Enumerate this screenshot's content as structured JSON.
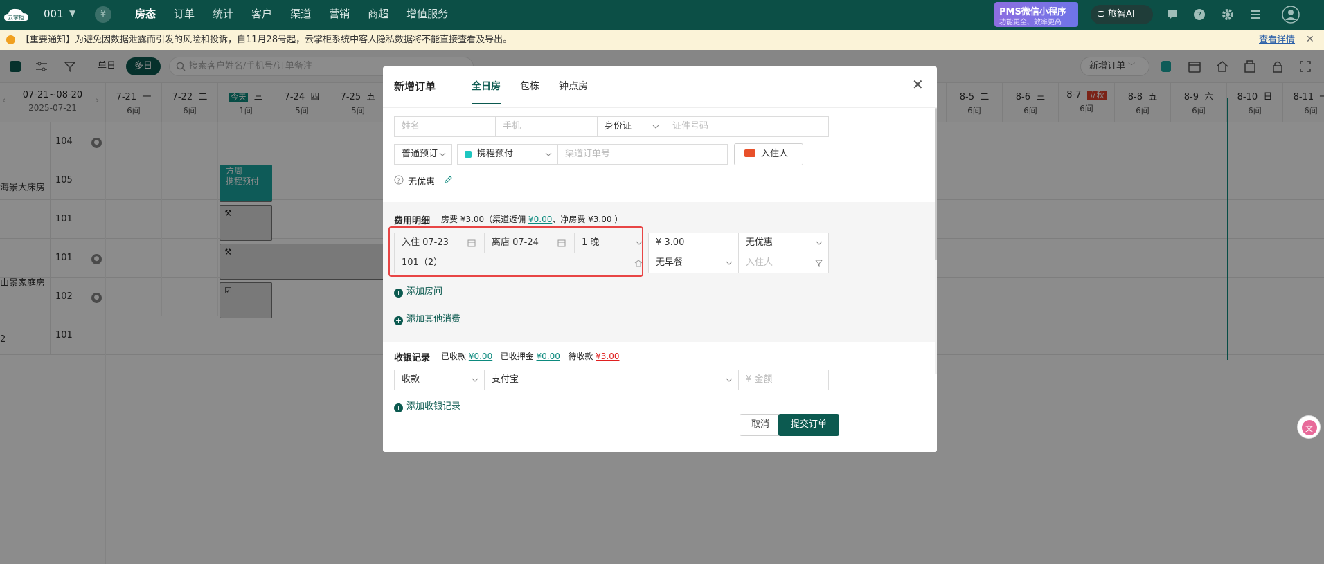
{
  "nav": {
    "logo_text": "云掌柜",
    "hotel": "001",
    "menu": [
      "房态",
      "订单",
      "统计",
      "客户",
      "渠道",
      "营销",
      "商超",
      "增值服务"
    ],
    "pms_title": "PMS微信小程序",
    "pms_sub": "功能更全、效率更高",
    "ai_label": "旅智AI",
    "yen_symbol": "¥"
  },
  "notice": {
    "message": "【重要通知】为避免因数据泄露而引发的风险和投诉，自11月28号起，云掌柜系统中客人隐私数据将不能直接查看及导出。",
    "link": "查看详情",
    "close": "✕"
  },
  "toolbar": {
    "single_day": "单日",
    "multi_day": "多日",
    "search_placeholder": "搜索客户姓名/手机号/订单备注",
    "new_order": "新增订单"
  },
  "calendar": {
    "range": "07-21~08-20",
    "range_date": "2025-07-21",
    "today_badge": "今天",
    "holiday_badge": "立秋",
    "days_left": [
      {
        "d": "7-21",
        "w": "一",
        "c": "6间"
      },
      {
        "d": "7-22",
        "w": "二",
        "c": "6间"
      },
      {
        "d": "",
        "w": "三",
        "c": "1间"
      },
      {
        "d": "7-24",
        "w": "四",
        "c": "5间"
      },
      {
        "d": "7-25",
        "w": "五",
        "c": "5间"
      }
    ],
    "days_right": [
      {
        "d": "8-5",
        "w": "二",
        "c": "6间"
      },
      {
        "d": "8-6",
        "w": "三",
        "c": "6间"
      },
      {
        "d": "8-7",
        "w": "",
        "c": "6间"
      },
      {
        "d": "8-8",
        "w": "五",
        "c": "6间"
      },
      {
        "d": "8-9",
        "w": "六",
        "c": "6间"
      },
      {
        "d": "8-10",
        "w": "日",
        "c": "6间"
      },
      {
        "d": "8-11",
        "w": "一",
        "c": "6间"
      }
    ],
    "room_types": [
      "海景大床房",
      "山景家庭房",
      "2"
    ],
    "rooms": [
      "104",
      "105",
      "101",
      "101",
      "102",
      "101"
    ],
    "booking_text": "方周\n携程预付"
  },
  "modal": {
    "title": "新增订单",
    "tabs": [
      "全日房",
      "包栋",
      "钟点房"
    ],
    "name_placeholder": "姓名",
    "phone_placeholder": "手机",
    "id_type": "身份证",
    "id_placeholder": "证件号码",
    "booking_type": "普通预订",
    "channel": "携程预付",
    "channel_order_placeholder": "渠道订单号",
    "guest_button": "入住人",
    "no_discount": "无优惠",
    "fee_title": "费用明细",
    "fee_room_prefix": "房费 ¥3.00（渠道返佣 ",
    "fee_commission": "¥0.00",
    "fee_net": "、净房费 ¥3.00 ）",
    "checkin": "入住 07-23",
    "checkout": "离店 07-24",
    "nights": "1 晚",
    "price": "¥ 3.00",
    "discount_select": "无优惠",
    "room_select": "101（2）",
    "breakfast": "无早餐",
    "guest_placeholder": "入住人",
    "add_room": "添加房间",
    "add_other": "添加其他消费",
    "cashier_title": "收银记录",
    "received_label": "已收款",
    "received": "¥0.00",
    "deposit_label": "已收押金",
    "deposit": "¥0.00",
    "pending_label": "待收款",
    "pending": "¥3.00",
    "pay_type": "收款",
    "pay_method": "支付宝",
    "amount_placeholder": "¥ 金额",
    "add_cashier": "添加收银记录",
    "cancel": "取消",
    "submit": "提交订单",
    "close": "✕"
  }
}
